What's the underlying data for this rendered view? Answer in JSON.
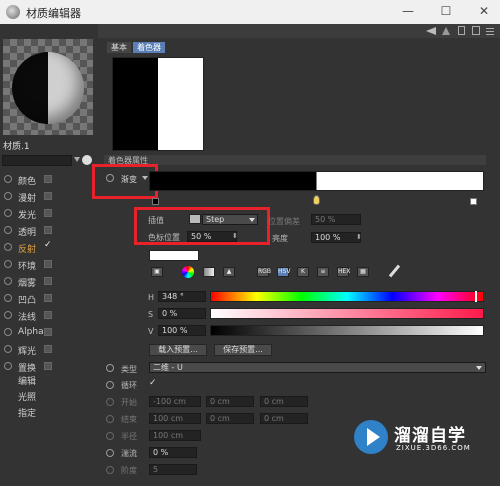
{
  "window": {
    "title": "材质编辑器",
    "btn_min": "—",
    "btn_max": "☐",
    "btn_close": "✕"
  },
  "material": {
    "name": "材质.1"
  },
  "channels": [
    {
      "label": "颜色",
      "checked": false
    },
    {
      "label": "漫射",
      "checked": false
    },
    {
      "label": "发光",
      "checked": false
    },
    {
      "label": "透明",
      "checked": false
    },
    {
      "label": "反射",
      "checked": true,
      "active": true
    },
    {
      "label": "环境",
      "checked": false
    },
    {
      "label": "烟雾",
      "checked": false
    },
    {
      "label": "凹凸",
      "checked": false
    },
    {
      "label": "法线",
      "checked": false
    },
    {
      "label": "Alpha",
      "checked": false
    },
    {
      "label": "辉光",
      "checked": false
    },
    {
      "label": "置换",
      "checked": false
    }
  ],
  "sub_items": [
    "编辑",
    "光照",
    "指定"
  ],
  "tabs": [
    "基本",
    "着色器"
  ],
  "section_label": "着色器属性",
  "gradient": {
    "label": "渐变",
    "interp_label": "插值",
    "interp_value": "Step",
    "pos_label": "色标位置",
    "pos_value": "50 %",
    "bias_label": "位置偏差",
    "bias_value": "50 %",
    "intensity_label": "亮度",
    "intensity_value": "100 %"
  },
  "hsv": {
    "h_label": "H",
    "h_value": "348 °",
    "s_label": "S",
    "s_value": "0 %",
    "v_label": "V",
    "v_value": "100 %"
  },
  "buttons": {
    "load_preset": "载入预置...",
    "save_preset": "保存预置..."
  },
  "props": {
    "type_label": "类型",
    "type_value": "二维 - U",
    "cycle_label": "循环",
    "start_label": "开始",
    "start_values": [
      "-100 cm",
      "0 cm",
      "0 cm"
    ],
    "end_label": "结束",
    "end_values": [
      "100 cm",
      "0 cm",
      "0 cm"
    ],
    "radius_label": "半径",
    "radius_value": "100 cm",
    "turbulence_label": "湍流",
    "turbulence_value": "0 %",
    "octaves_label": "阶度",
    "octaves_value": "5"
  },
  "watermark": {
    "brand": "溜溜自学",
    "url": "ZIXUE.3D66.COM"
  }
}
